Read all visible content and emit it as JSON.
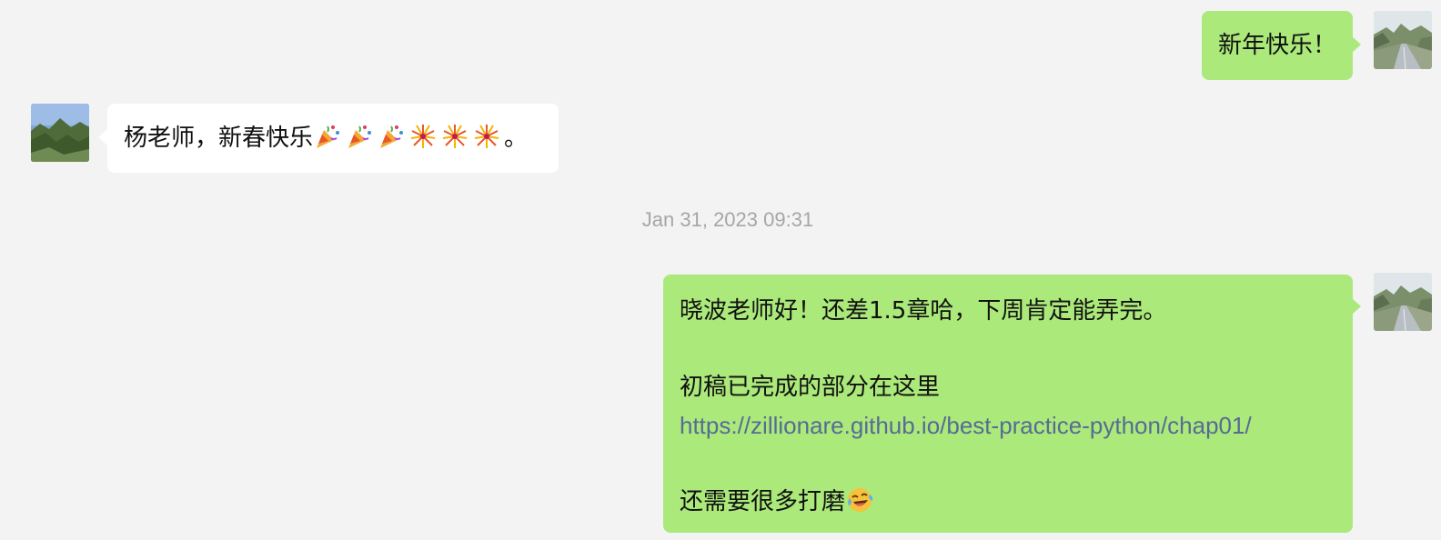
{
  "messages": {
    "m1": {
      "direction": "outgoing",
      "text": "新年快乐！"
    },
    "m2": {
      "direction": "incoming",
      "text": "杨老师，新春快乐",
      "emojis": [
        "party-popper-icon",
        "party-popper-icon",
        "party-popper-icon",
        "fireworks-icon",
        "fireworks-icon",
        "fireworks-icon"
      ],
      "suffix": "。"
    },
    "timestamp": "Jan 31, 2023 09:31",
    "m3": {
      "direction": "outgoing",
      "line1": "晓波老师好！还差1.5章哈，下周肯定能弄完。",
      "line2": "初稿已完成的部分在这里",
      "link": "https://zillionare.github.io/best-practice-python/chap01/",
      "line3": "还需要很多打磨",
      "end_emoji": "laughing-crying-icon"
    }
  },
  "colors": {
    "background": "#f3f3f3",
    "outgoing_bubble": "#abe97a",
    "incoming_bubble": "#ffffff",
    "link": "#576b95",
    "timestamp": "#a6a6a6"
  },
  "avatars": {
    "self": "road-avatar",
    "other": "mountain-avatar"
  }
}
